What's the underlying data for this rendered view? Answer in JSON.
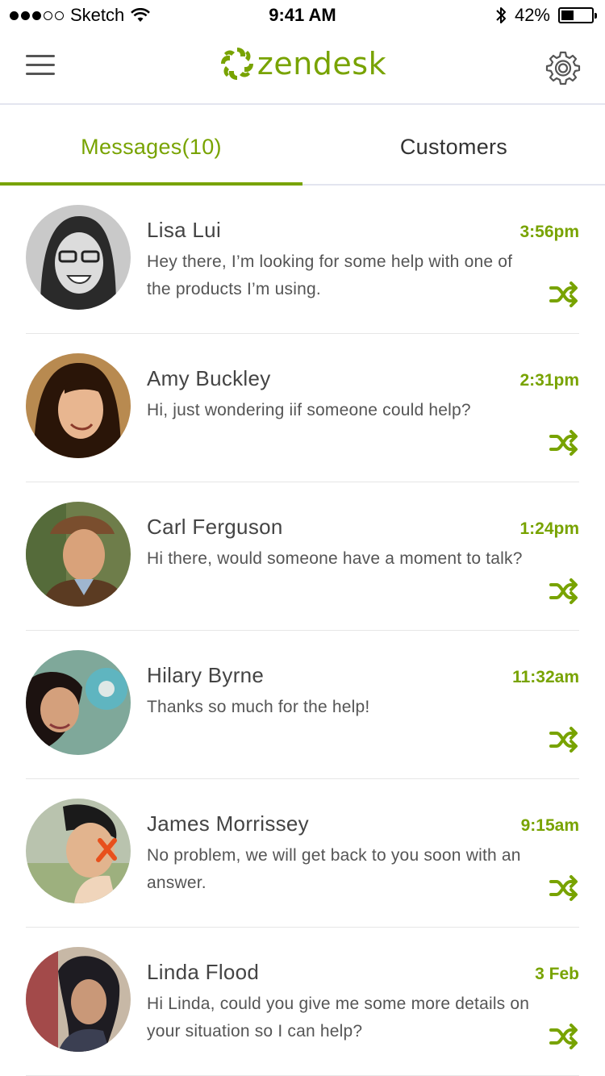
{
  "status_bar": {
    "carrier": "Sketch",
    "time": "9:41 AM",
    "battery": "42%",
    "battery_level": 0.42,
    "signal_bars_filled": 3,
    "signal_bars_total": 5
  },
  "header": {
    "logo_text": "zendesk",
    "menu_icon": "hamburger-icon",
    "settings_icon": "gear-icon"
  },
  "tabs": [
    {
      "label": "Messages(10)",
      "active": true
    },
    {
      "label": "Customers",
      "active": false
    }
  ],
  "messages": [
    {
      "name": "Lisa Lui",
      "time": "3:56pm",
      "text": "Hey there, I’m looking for some help with one of the products I’m using.",
      "action_icon": "shuffle-icon"
    },
    {
      "name": "Amy Buckley",
      "time": "2:31pm",
      "text": "Hi, just wondering iif someone could help?",
      "action_icon": "shuffle-icon"
    },
    {
      "name": "Carl Ferguson",
      "time": "1:24pm",
      "text": "Hi there, would someone have a moment to talk?",
      "action_icon": "shuffle-icon"
    },
    {
      "name": "Hilary Byrne",
      "time": "11:32am",
      "text": "Thanks so much for the help!",
      "action_icon": "shuffle-icon"
    },
    {
      "name": "James Morrissey",
      "time": "9:15am",
      "text": "No problem, we will get back to you soon with an answer.",
      "action_icon": "shuffle-icon"
    },
    {
      "name": "Linda Flood",
      "time": "3 Feb",
      "text": "Hi Linda, could you give me some more details on your situation so I can help?",
      "action_icon": "shuffle-icon"
    }
  ],
  "colors": {
    "accent": "#78a300",
    "text": "#333333",
    "divider": "#e3e5ef"
  }
}
